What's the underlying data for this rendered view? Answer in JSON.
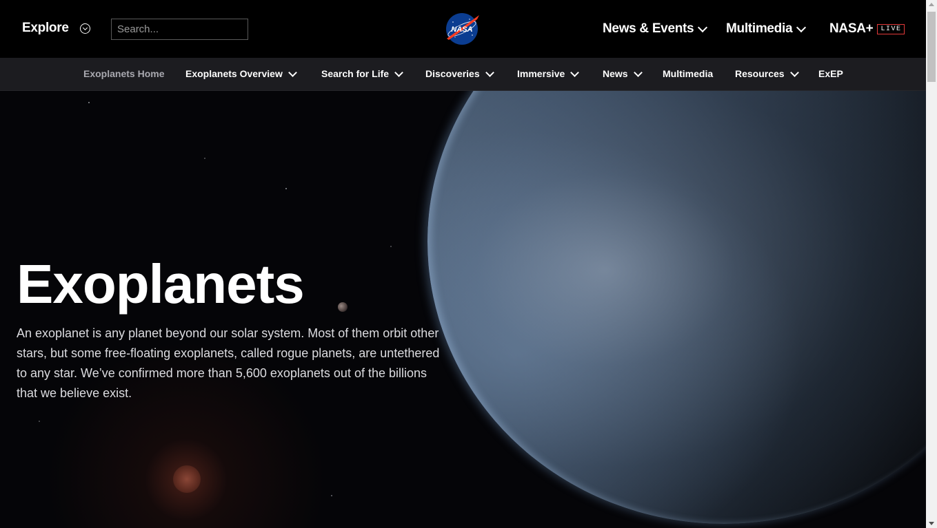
{
  "header": {
    "explore_label": "Explore",
    "search_placeholder": "Search...",
    "logo_text": "NASA",
    "nav": [
      {
        "label": "News & Events"
      },
      {
        "label": "Multimedia"
      },
      {
        "label": "NASA+",
        "badge": "LIVE"
      }
    ]
  },
  "subnav": {
    "items": [
      {
        "label": "Exoplanets Home"
      },
      {
        "label": "Exoplanets Overview"
      },
      {
        "label": "Search for Life"
      },
      {
        "label": "Discoveries"
      },
      {
        "label": "Immersive"
      },
      {
        "label": "News"
      },
      {
        "label": "Multimedia"
      },
      {
        "label": "Resources"
      },
      {
        "label": "ExEP"
      }
    ]
  },
  "hero": {
    "title": "Exoplanets",
    "description": "An exoplanet is any planet beyond our solar system. Most of them orbit other stars, but some free-floating exoplanets, called rogue planets, are untethered to any star. We’ve confirmed more than 5,600 exoplanets out of the billions that we believe exist."
  },
  "colors": {
    "header_bg": "#000000",
    "subnav_bg": "#1c1c20",
    "live_badge_border": "#e43a3a",
    "nasa_blue": "#0b3d91",
    "nasa_red": "#fc3d21"
  }
}
